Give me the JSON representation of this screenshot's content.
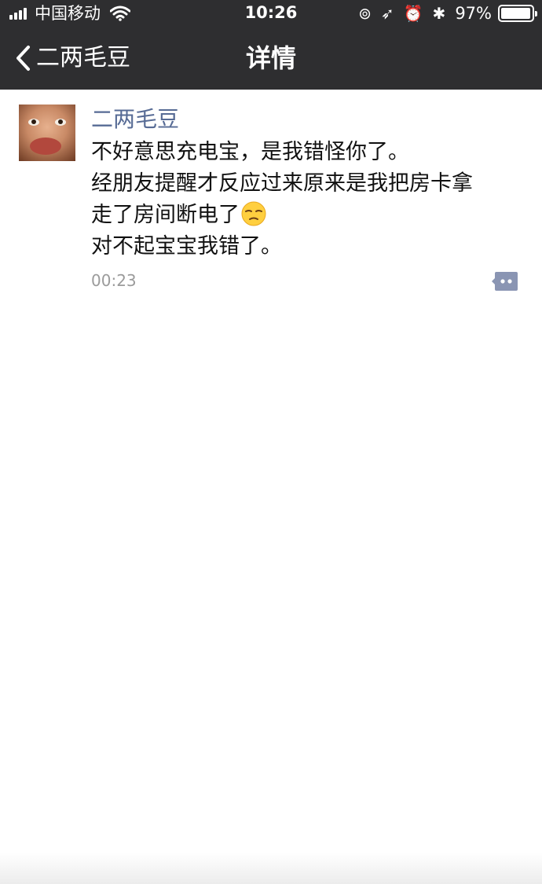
{
  "status_bar": {
    "carrier": "中国移动",
    "time": "10:26",
    "battery_percent": "97%",
    "battery_level": 0.97,
    "icons": [
      "signal-icon",
      "wifi-icon",
      "orientation-lock-icon",
      "location-icon",
      "alarm-icon",
      "bluetooth-icon",
      "battery-icon"
    ]
  },
  "nav": {
    "back_label": "二两毛豆",
    "title": "详情"
  },
  "post": {
    "author": "二两毛豆",
    "lines": [
      "不好意思充电宝，是我错怪你了。",
      "经朋友提醒才反应过来原来是我把房卡拿",
      "走了房间断电了",
      "对不起宝宝我错了。"
    ],
    "emoji": "unamused-face-emoji",
    "time": "00:23",
    "comment_icon": "comment-icon"
  },
  "colors": {
    "bar_background": "#2e2e30",
    "author_link": "#576b95",
    "timestamp": "#9b9b9b",
    "comment_icon": "#8a95b3"
  }
}
